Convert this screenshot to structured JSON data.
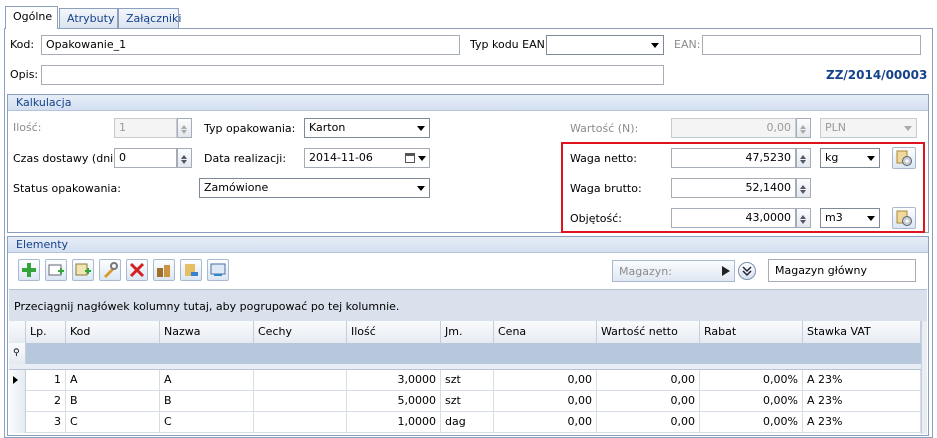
{
  "tabs": [
    "Ogólne",
    "Atrybuty",
    "Załączniki"
  ],
  "header": {
    "kod_label": "Kod:",
    "kod_value": "Opakowanie_1",
    "typ_kodu_label": "Typ kodu EAN:",
    "typ_kodu_value": "",
    "ean_label": "EAN:",
    "ean_value": "",
    "opis_label": "Opis:",
    "opis_value": "",
    "doc_number": "ZZ/2014/00003"
  },
  "kalkulacja": {
    "title": "Kalkulacja",
    "ilosc_label": "Ilość:",
    "ilosc_value": "1",
    "czas_label": "Czas dostawy (dni):",
    "czas_value": "0",
    "status_label": "Status opakowania:",
    "status_value": "Zamówione",
    "typ_label": "Typ opakowania:",
    "typ_value": "Karton",
    "data_label": "Data realizacji:",
    "data_value": "2014-11-06",
    "wartosc_label": "Wartość (N):",
    "wartosc_value": "0,00",
    "waluta_value": "PLN",
    "netto_label": "Waga netto:",
    "netto_value": "47,5230",
    "netto_unit": "kg",
    "brutto_label": "Waga brutto:",
    "brutto_value": "52,1400",
    "objetosc_label": "Objętość:",
    "objetosc_value": "43,0000",
    "objetosc_unit": "m3",
    "highlight_color": "#e0121b"
  },
  "elementy": {
    "title": "Elementy",
    "magazyn_label": "Magazyn:",
    "magazyn_value": "Magazyn główny",
    "group_hint": "Przeciągnij nagłówek kolumny tutaj, aby pogrupować po tej kolumnie.",
    "toolbar_icons": [
      "add-icon",
      "add-from-list-icon",
      "add-multiple-icon",
      "edit-icon",
      "delete-icon",
      "stock-icon",
      "import-icon",
      "refresh-icon"
    ],
    "columns": [
      "Lp.",
      "Kod",
      "Nazwa",
      "Cechy",
      "Ilość",
      "Jm.",
      "Cena",
      "Wartość netto",
      "Rabat",
      "Stawka VAT"
    ],
    "rows": [
      {
        "lp": "1",
        "kod": "A",
        "nazwa": "A",
        "cechy": "",
        "ilosc": "3,0000",
        "jm": "szt",
        "cena": "0,00",
        "wartosc": "0,00",
        "rabat": "0,00%",
        "vat": "A 23%"
      },
      {
        "lp": "2",
        "kod": "B",
        "nazwa": "B",
        "cechy": "",
        "ilosc": "5,0000",
        "jm": "szt",
        "cena": "0,00",
        "wartosc": "0,00",
        "rabat": "0,00%",
        "vat": "A 23%"
      },
      {
        "lp": "3",
        "kod": "C",
        "nazwa": "C",
        "cechy": "",
        "ilosc": "1,0000",
        "jm": "dag",
        "cena": "0,00",
        "wartosc": "0,00",
        "rabat": "0,00%",
        "vat": "A 23%"
      }
    ]
  }
}
